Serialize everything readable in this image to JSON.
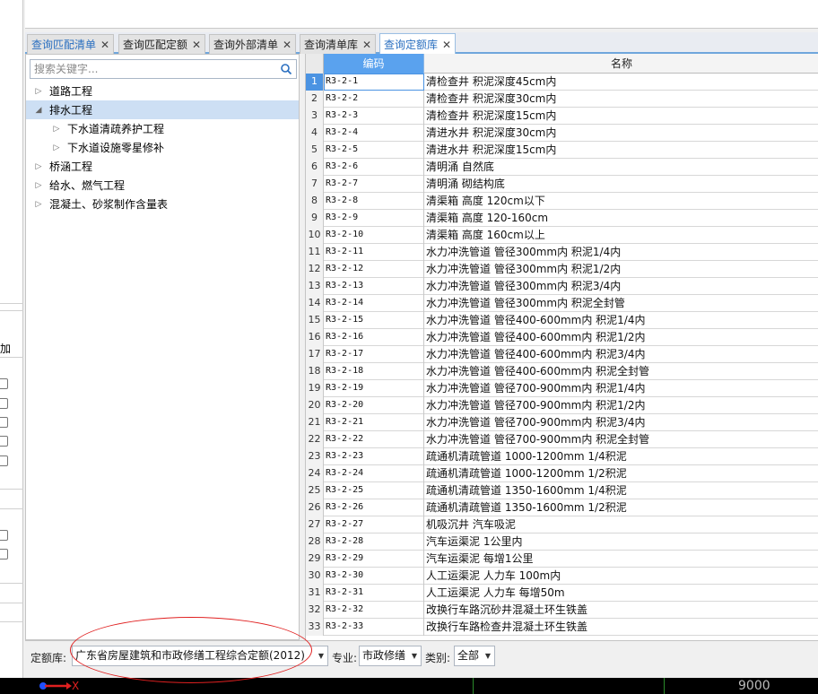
{
  "left_strip": {
    "label": "加"
  },
  "tabs": [
    {
      "label": "查询匹配清单",
      "highlight": true,
      "active": false
    },
    {
      "label": "查询匹配定额",
      "highlight": false,
      "active": false
    },
    {
      "label": "查询外部清单",
      "highlight": false,
      "active": false
    },
    {
      "label": "查询清单库",
      "highlight": false,
      "active": false
    },
    {
      "label": "查询定额库",
      "highlight": true,
      "active": true
    }
  ],
  "tab_close": "✕",
  "search": {
    "placeholder": "搜索关键字..."
  },
  "tree": [
    {
      "label": "道路工程",
      "level": 0,
      "expanded": false,
      "selected": false
    },
    {
      "label": "排水工程",
      "level": 0,
      "expanded": true,
      "selected": true
    },
    {
      "label": "下水道清疏养护工程",
      "level": 1,
      "expanded": false,
      "selected": false
    },
    {
      "label": "下水道设施零星修补",
      "level": 1,
      "expanded": false,
      "selected": false
    },
    {
      "label": "桥涵工程",
      "level": 0,
      "expanded": false,
      "selected": false
    },
    {
      "label": "给水、燃气工程",
      "level": 0,
      "expanded": false,
      "selected": false
    },
    {
      "label": "混凝土、砂浆制作含量表",
      "level": 0,
      "expanded": false,
      "selected": false
    }
  ],
  "table": {
    "headers": {
      "code": "编码",
      "name": "名称"
    },
    "rows": [
      {
        "num": "1",
        "code": "R3-2-1",
        "name": "清检查井 积泥深度45cm内"
      },
      {
        "num": "2",
        "code": "R3-2-2",
        "name": "清检查井 积泥深度30cm内"
      },
      {
        "num": "3",
        "code": "R3-2-3",
        "name": "清检查井 积泥深度15cm内"
      },
      {
        "num": "4",
        "code": "R3-2-4",
        "name": "清进水井 积泥深度30cm内"
      },
      {
        "num": "5",
        "code": "R3-2-5",
        "name": "清进水井 积泥深度15cm内"
      },
      {
        "num": "6",
        "code": "R3-2-6",
        "name": "清明涌 自然底"
      },
      {
        "num": "7",
        "code": "R3-2-7",
        "name": "清明涌 砌结构底"
      },
      {
        "num": "8",
        "code": "R3-2-8",
        "name": "清渠箱 高度 120cm以下"
      },
      {
        "num": "9",
        "code": "R3-2-9",
        "name": "清渠箱 高度 120-160cm"
      },
      {
        "num": "10",
        "code": "R3-2-10",
        "name": "清渠箱 高度 160cm以上"
      },
      {
        "num": "11",
        "code": "R3-2-11",
        "name": "水力冲洗管道 管径300mm内 积泥1/4内"
      },
      {
        "num": "12",
        "code": "R3-2-12",
        "name": "水力冲洗管道 管径300mm内 积泥1/2内"
      },
      {
        "num": "13",
        "code": "R3-2-13",
        "name": "水力冲洗管道 管径300mm内 积泥3/4内"
      },
      {
        "num": "14",
        "code": "R3-2-14",
        "name": "水力冲洗管道 管径300mm内 积泥全封管"
      },
      {
        "num": "15",
        "code": "R3-2-15",
        "name": "水力冲洗管道 管径400-600mm内 积泥1/4内"
      },
      {
        "num": "16",
        "code": "R3-2-16",
        "name": "水力冲洗管道 管径400-600mm内 积泥1/2内"
      },
      {
        "num": "17",
        "code": "R3-2-17",
        "name": "水力冲洗管道 管径400-600mm内 积泥3/4内"
      },
      {
        "num": "18",
        "code": "R3-2-18",
        "name": "水力冲洗管道 管径400-600mm内 积泥全封管"
      },
      {
        "num": "19",
        "code": "R3-2-19",
        "name": "水力冲洗管道 管径700-900mm内 积泥1/4内"
      },
      {
        "num": "20",
        "code": "R3-2-20",
        "name": "水力冲洗管道 管径700-900mm内 积泥1/2内"
      },
      {
        "num": "21",
        "code": "R3-2-21",
        "name": "水力冲洗管道 管径700-900mm内 积泥3/4内"
      },
      {
        "num": "22",
        "code": "R3-2-22",
        "name": "水力冲洗管道 管径700-900mm内 积泥全封管"
      },
      {
        "num": "23",
        "code": "R3-2-23",
        "name": "疏通机清疏管道 1000-1200mm 1/4积泥"
      },
      {
        "num": "24",
        "code": "R3-2-24",
        "name": "疏通机清疏管道 1000-1200mm 1/2积泥"
      },
      {
        "num": "25",
        "code": "R3-2-25",
        "name": "疏通机清疏管道 1350-1600mm 1/4积泥"
      },
      {
        "num": "26",
        "code": "R3-2-26",
        "name": "疏通机清疏管道 1350-1600mm 1/2积泥"
      },
      {
        "num": "27",
        "code": "R3-2-27",
        "name": "机吸沉井 汽车吸泥"
      },
      {
        "num": "28",
        "code": "R3-2-28",
        "name": "汽车运渠泥 1公里内"
      },
      {
        "num": "29",
        "code": "R3-2-29",
        "name": "汽车运渠泥 每增1公里"
      },
      {
        "num": "30",
        "code": "R3-2-30",
        "name": "人工运渠泥 人力车 100m内"
      },
      {
        "num": "31",
        "code": "R3-2-31",
        "name": "人工运渠泥 人力车 每增50m"
      },
      {
        "num": "32",
        "code": "R3-2-32",
        "name": "改换行车路沉砂井混凝土环生铁盖"
      },
      {
        "num": "33",
        "code": "R3-2-33",
        "name": "改换行车路检查井混凝土环生铁盖"
      }
    ]
  },
  "filter": {
    "quota_label": "定额库:",
    "quota_value": "广东省房屋建筑和市政修缮工程综合定额(2012)",
    "major_label": "专业:",
    "major_value": "市政修缮",
    "category_label": "类别:",
    "category_value": "全部"
  },
  "status": {
    "axis_label": "X",
    "coordinate": "9000"
  },
  "colors": {
    "accent": "#5aa2ee",
    "tab_highlight": "#2a6fc0",
    "selected_tree": "#cddff4",
    "annotation": "#e02020"
  }
}
